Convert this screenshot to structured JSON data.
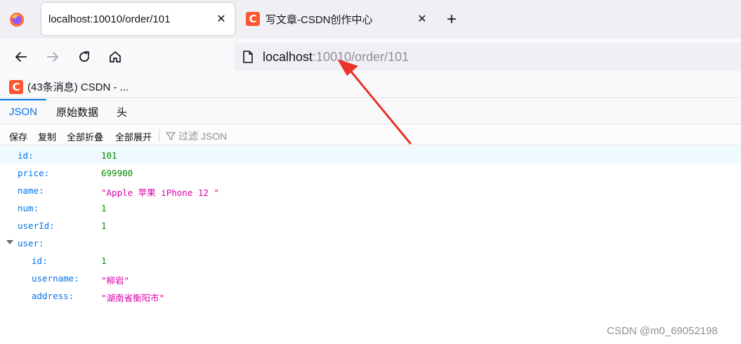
{
  "browser": {
    "tabs": [
      {
        "title": "localhost:10010/order/101",
        "active": true
      },
      {
        "title": "写文章-CSDN创作中心",
        "active": false,
        "favicon": "csdn-icon"
      }
    ],
    "url": {
      "host": "localhost",
      "rest": ":10010/order/101"
    },
    "bookmarks": [
      {
        "label": "(43条消息) CSDN - ...",
        "favicon": "csdn-icon"
      }
    ]
  },
  "viewer": {
    "tabs": [
      "JSON",
      "原始数据",
      "头"
    ],
    "toolbar": {
      "save": "保存",
      "copy": "复制",
      "collapse_all": "全部折叠",
      "expand_all": "全部展开",
      "filter_placeholder": "过滤 JSON"
    },
    "rows": [
      {
        "key": "id:",
        "value": "101",
        "type": "number"
      },
      {
        "key": "price:",
        "value": "699900",
        "type": "number"
      },
      {
        "key": "name:",
        "value": "\"Apple 苹果 iPhone 12 \"",
        "type": "string"
      },
      {
        "key": "num:",
        "value": "1",
        "type": "number"
      },
      {
        "key": "userId:",
        "value": "1",
        "type": "number"
      },
      {
        "key": "user:",
        "value": "",
        "type": "object"
      },
      {
        "key": "id:",
        "value": "1",
        "type": "number"
      },
      {
        "key": "username:",
        "value": "\"柳岩\"",
        "type": "string"
      },
      {
        "key": "address:",
        "value": "\"湖南省衡阳市\"",
        "type": "string"
      }
    ]
  },
  "watermark": "CSDN @m0_69052198",
  "colors": {
    "accent": "#0074e8",
    "number": "#058b00",
    "string": "#dd00a9",
    "annotation_arrow": "#e8332a",
    "csdn": "#fc5531"
  }
}
